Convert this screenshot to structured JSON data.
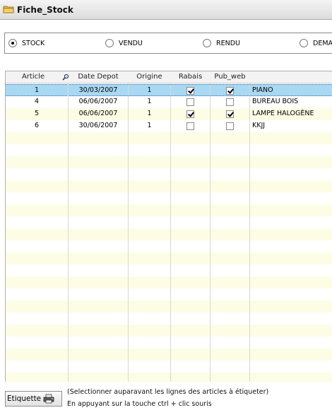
{
  "window": {
    "title": "Fiche_Stock"
  },
  "filter": {
    "options": [
      {
        "label": "STOCK",
        "selected": true
      },
      {
        "label": "VENDU",
        "selected": false
      },
      {
        "label": "RENDU",
        "selected": false
      },
      {
        "label": "DEMAR",
        "selected": false
      }
    ]
  },
  "table": {
    "columns": [
      "Article",
      "Date Depot",
      "Origine",
      "Rabais",
      "Pub_web",
      ""
    ],
    "rows": [
      {
        "article": "1",
        "date": "30/03/2007",
        "origine": "1",
        "rabais": true,
        "pub_web": true,
        "designation": "PIANO",
        "selected": true
      },
      {
        "article": "4",
        "date": "06/06/2007",
        "origine": "1",
        "rabais": false,
        "pub_web": false,
        "designation": "BUREAU BOIS",
        "selected": false
      },
      {
        "article": "5",
        "date": "06/06/2007",
        "origine": "1",
        "rabais": true,
        "pub_web": true,
        "designation": "LAMPE HALOGÈNE",
        "selected": false
      },
      {
        "article": "6",
        "date": "30/06/2007",
        "origine": "1",
        "rabais": false,
        "pub_web": false,
        "designation": "KKJJ",
        "selected": false
      }
    ],
    "row_colors": {
      "odd": "#fdfde6",
      "even": "#ffffff",
      "selected": "#a9d8f2"
    }
  },
  "footer": {
    "button_label": "Etiquette",
    "note_line1": "(Selectionner auparavant les lignes des articles à étiqueter)",
    "note_line2": "En appuyant sur la touche ctrl + clic souris"
  }
}
